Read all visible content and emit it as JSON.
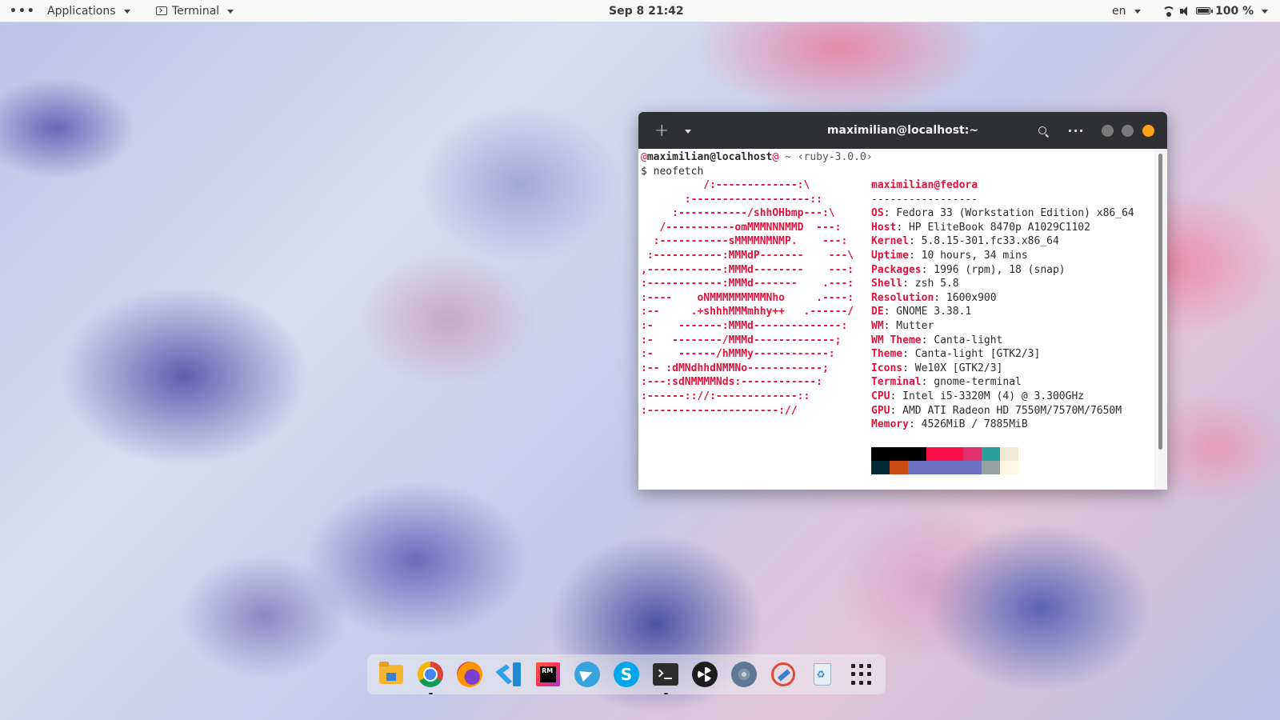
{
  "topbar": {
    "activities_label": "•••",
    "applications_label": "Applications",
    "app_menu_label": "Terminal",
    "clock": "Sep 8  21:42",
    "keyboard_layout": "en",
    "battery": "100 %"
  },
  "terminal": {
    "title": "maximilian@localhost:~",
    "new_tab_icon": "+",
    "menu_icon": "···",
    "prompt": {
      "at1": "@",
      "user_host": "maximilian@localhost",
      "at2": "@",
      "path": " ~ ",
      "ruby": "‹ruby-3.0.0›"
    },
    "command": "$ neofetch",
    "logo_lines": [
      "          /:-------------:\\",
      "       :-------------------::",
      "     :-----------/shhOHbmp---:\\",
      "   /-----------omMMMNNNMMD  ---:",
      "  :-----------sMMMMNMNMP.    ---:",
      " :-----------:MMMdP-------    ---\\",
      ",------------:MMMd--------    ---:",
      ":------------:MMMd-------    .---:",
      ":----    oNMMMMMMMMMNho     .----:",
      ":--     .+shhhMMMmhhy++   .------/",
      ":-    -------:MMMd--------------:",
      ":-   --------/MMMd-------------;",
      ":-    ------/hMMMy------------:",
      ":-- :dMNdhhdNMMNo------------;",
      ":---:sdNMMMMNds:------------:",
      ":------:://:-------------::",
      ":---------------------://"
    ],
    "header": "maximilian@fedora",
    "separator": "-----------------",
    "info": [
      {
        "key": "OS",
        "value": ": Fedora 33 (Workstation Edition) x86_64"
      },
      {
        "key": "Host",
        "value": ": HP EliteBook 8470p A1029C1102"
      },
      {
        "key": "Kernel",
        "value": ": 5.8.15-301.fc33.x86_64"
      },
      {
        "key": "Uptime",
        "value": ": 10 hours, 34 mins"
      },
      {
        "key": "Packages",
        "value": ": 1996 (rpm), 18 (snap)"
      },
      {
        "key": "Shell",
        "value": ": zsh 5.8"
      },
      {
        "key": "Resolution",
        "value": ": 1600x900"
      },
      {
        "key": "DE",
        "value": ": GNOME 3.38.1"
      },
      {
        "key": "WM",
        "value": ": Mutter"
      },
      {
        "key": "WM Theme",
        "value": ": Canta-light"
      },
      {
        "key": "Theme",
        "value": ": Canta-light [GTK2/3]"
      },
      {
        "key": "Icons",
        "value": ": We10X [GTK2/3]"
      },
      {
        "key": "Terminal",
        "value": ": gnome-terminal"
      },
      {
        "key": "CPU",
        "value": ": Intel i5-3320M (4) @ 3.300GHz"
      },
      {
        "key": "GPU",
        "value": ": AMD ATI Radeon HD 7550M/7570M/7650M"
      },
      {
        "key": "Memory",
        "value": ": 4526MiB / 7885MiB"
      }
    ],
    "palette_top": [
      "#000000",
      "#000000",
      "#000000",
      "#ff0f47",
      "#ff0f47",
      "#e0306e",
      "#2aa198",
      "#eee8d5"
    ],
    "palette_bottom": [
      "#002b36",
      "#cb4b16",
      "#6c71c4",
      "#6c71c4",
      "#6c71c4",
      "#6c71c4",
      "#93a1a1",
      "#fdf6e3"
    ]
  },
  "dock": {
    "items": [
      {
        "name": "files-icon"
      },
      {
        "name": "chrome-icon",
        "running": true
      },
      {
        "name": "firefox-icon"
      },
      {
        "name": "vscode-icon"
      },
      {
        "name": "rubymine-icon",
        "label": "RM"
      },
      {
        "name": "telegram-icon"
      },
      {
        "name": "skype-icon",
        "label": "S"
      },
      {
        "name": "terminal-icon",
        "running": true
      },
      {
        "name": "obs-icon"
      },
      {
        "name": "settings-icon"
      },
      {
        "name": "tool-icon"
      },
      {
        "name": "trash-icon"
      },
      {
        "name": "show-applications-icon"
      }
    ]
  }
}
